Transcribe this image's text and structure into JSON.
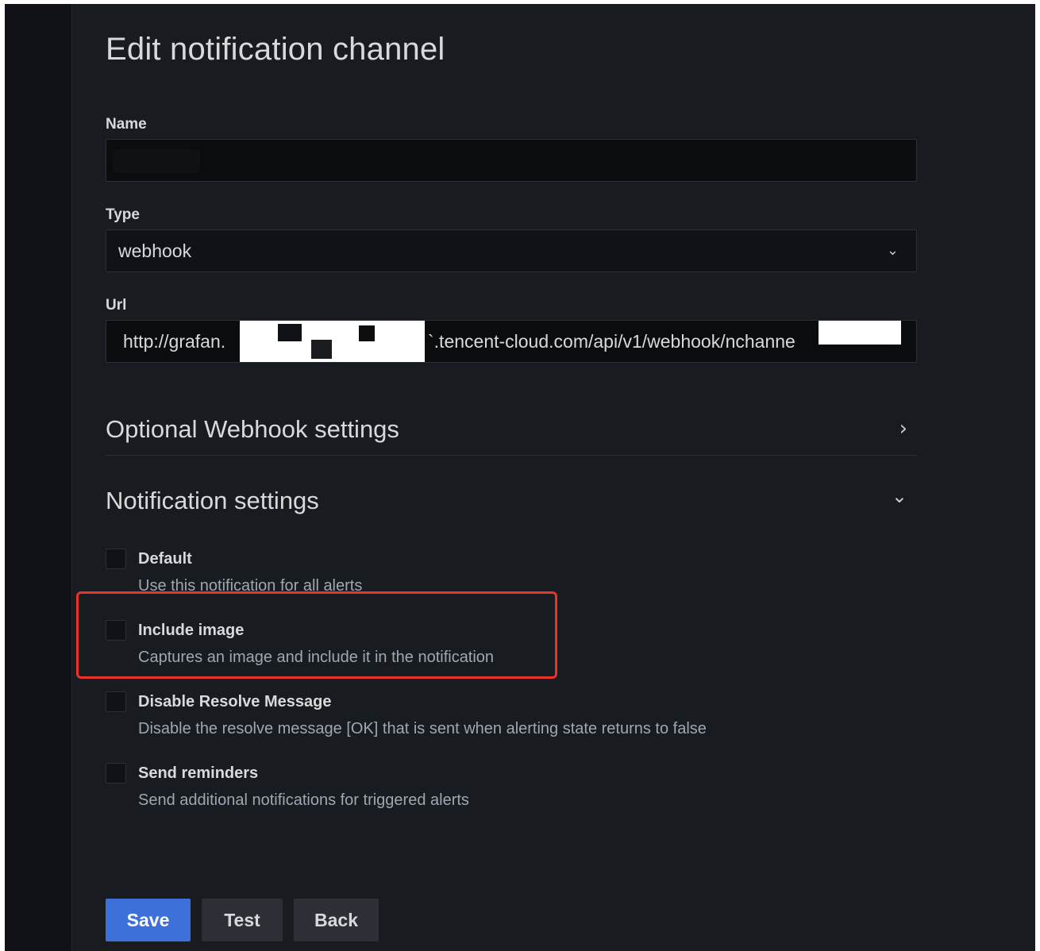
{
  "page": {
    "title": "Edit notification channel"
  },
  "form": {
    "name": {
      "label": "Name",
      "value": ""
    },
    "type": {
      "label": "Type",
      "value": "webhook"
    },
    "url": {
      "label": "Url",
      "value_start": "http://grafan.",
      "value_end": "`.tencent-cloud.com/api/v1/webhook/nchanne"
    }
  },
  "sections": {
    "optional_webhook": {
      "title": "Optional Webhook settings",
      "expanded": false
    },
    "notification": {
      "title": "Notification settings",
      "expanded": true
    }
  },
  "options": [
    {
      "label": "Default",
      "description": "Use this notification for all alerts",
      "checked": false
    },
    {
      "label": "Include image",
      "description": "Captures an image and include it in the notification",
      "checked": false
    },
    {
      "label": "Disable Resolve Message",
      "description": "Disable the resolve message [OK] that is sent when alerting state returns to false",
      "checked": false
    },
    {
      "label": "Send reminders",
      "description": "Send additional notifications for triggered alerts",
      "checked": false
    }
  ],
  "buttons": {
    "save": "Save",
    "test": "Test",
    "back": "Back"
  },
  "colors": {
    "background": "#181b1f",
    "input_background": "#0b0c0e",
    "primary_button": "#3d71d9",
    "secondary_button": "#2c3036",
    "highlight": "#e8352b",
    "text": "#d8d9da",
    "muted_text": "#9fa7b3"
  },
  "icons": {
    "type_dropdown": "chevron-down-icon",
    "optional_webhook_toggle": "chevron-right-icon",
    "notification_toggle": "chevron-down-icon"
  }
}
